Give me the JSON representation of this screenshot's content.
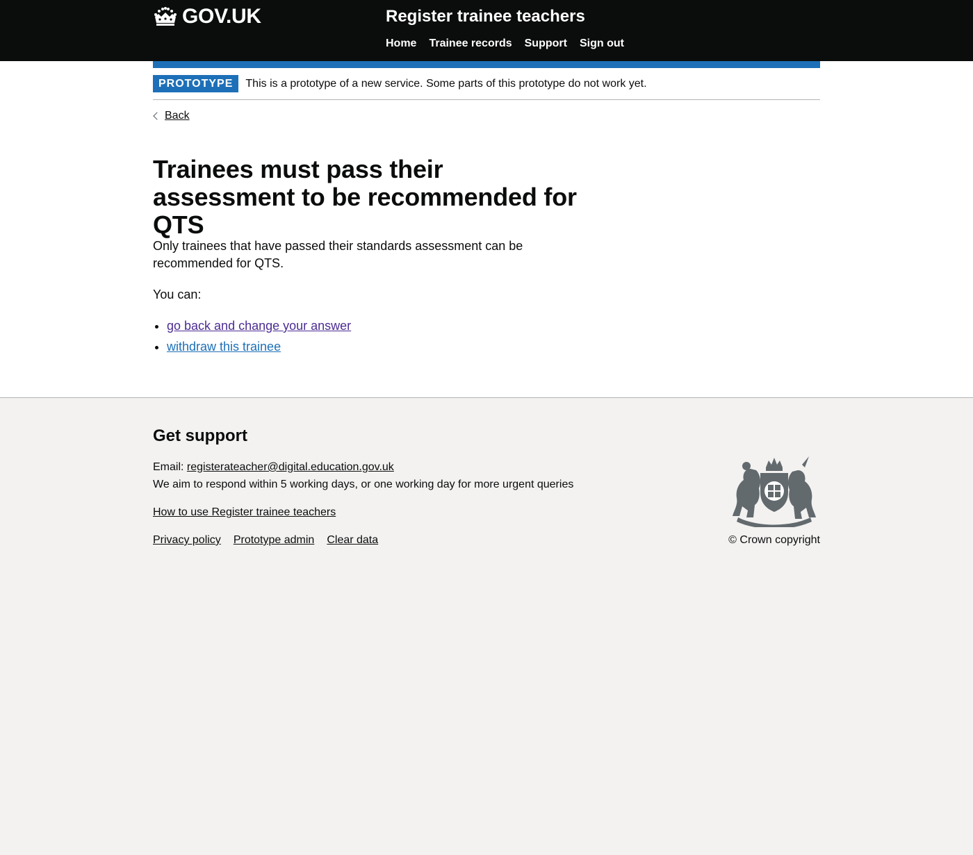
{
  "header": {
    "logo_text": "GOV.UK",
    "service_name": "Register trainee teachers",
    "nav": [
      "Home",
      "Trainee records",
      "Support",
      "Sign out"
    ]
  },
  "phase_banner": {
    "tag": "PROTOTYPE",
    "text": "This is a prototype of a new service. Some parts of this prototype do not work yet."
  },
  "back_link": "Back",
  "main": {
    "title": "Trainees must pass their assessment to be recommended for QTS",
    "lede": "Only trainees that have passed their standards assessment can be recommended for QTS.",
    "you_can": "You can:",
    "actions": [
      "go back and change your answer",
      "withdraw this trainee"
    ]
  },
  "footer": {
    "heading": "Get support",
    "email_label": "Email:",
    "email": "registerateacher@digital.education.gov.uk",
    "response_text": "We aim to respond within 5 working days, or one working day for more urgent queries",
    "how_to_link": "How to use Register trainee teachers",
    "links": [
      "Privacy policy",
      "Prototype admin",
      "Clear data"
    ],
    "copyright": "© Crown copyright"
  },
  "colors": {
    "header_bg": "#0b0c0c",
    "brand_blue": "#1d70b8",
    "visited_link": "#4c2c92",
    "footer_bg": "#f3f2f1"
  },
  "icons": [
    "crown-icon",
    "chevron-left-icon",
    "royal-coat-of-arms-icon"
  ]
}
